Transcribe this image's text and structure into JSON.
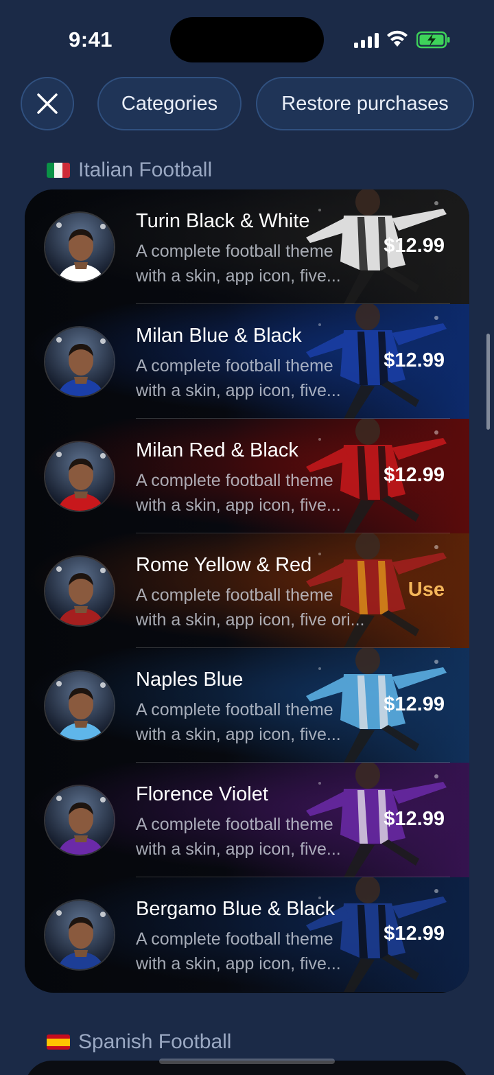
{
  "status_bar": {
    "time": "9:41"
  },
  "top_buttons": {
    "categories": "Categories",
    "restore": "Restore purchases"
  },
  "sections": [
    {
      "title": "Italian Football",
      "flag": "italy-flag",
      "items": [
        {
          "title": "Turin Black & White",
          "desc_line1": "A complete football theme",
          "desc_line2": "with a skin, app icon, five...",
          "action": "$12.99",
          "accent": "#1a1a1a",
          "kit": "#ffffff",
          "kit2": "#111111"
        },
        {
          "title": "Milan Blue & Black",
          "desc_line1": "A complete football theme",
          "desc_line2": "with a skin, app icon, five...",
          "action": "$12.99",
          "accent": "#0d2a6b",
          "kit": "#1b3fa8",
          "kit2": "#0a0a0a"
        },
        {
          "title": "Milan Red & Black",
          "desc_line1": "A complete football theme",
          "desc_line2": "with a skin, app icon, five...",
          "action": "$12.99",
          "accent": "#5a0b0b",
          "kit": "#c8181c",
          "kit2": "#111111"
        },
        {
          "title": "Rome Yellow & Red",
          "desc_line1": "A complete football theme",
          "desc_line2": "with a skin, app icon, five ori...",
          "action": "Use",
          "accent": "#5a2208",
          "kit": "#a51f1f",
          "kit2": "#f1a81c"
        },
        {
          "title": "Naples Blue",
          "desc_line1": "A complete football theme",
          "desc_line2": "with a skin, app icon, five...",
          "action": "$12.99",
          "accent": "#10305a",
          "kit": "#5fb6ea",
          "kit2": "#ffffff"
        },
        {
          "title": "Florence Violet",
          "desc_line1": "A complete football theme",
          "desc_line2": "with a skin, app icon, five...",
          "action": "$12.99",
          "accent": "#35134f",
          "kit": "#6b2aa8",
          "kit2": "#ffffff"
        },
        {
          "title": "Bergamo Blue & Black",
          "desc_line1": "A complete football theme",
          "desc_line2": "with a skin, app icon, five...",
          "action": "$12.99",
          "accent": "#0c2044",
          "kit": "#1d3e96",
          "kit2": "#0a0a0a"
        }
      ]
    },
    {
      "title": "Spanish Football",
      "flag": "spain-flag"
    }
  ],
  "colors": {
    "background": "#1b2a47",
    "use_accent": "#f4b65a",
    "button_fill": "#1f3457",
    "button_border": "#30507f"
  }
}
